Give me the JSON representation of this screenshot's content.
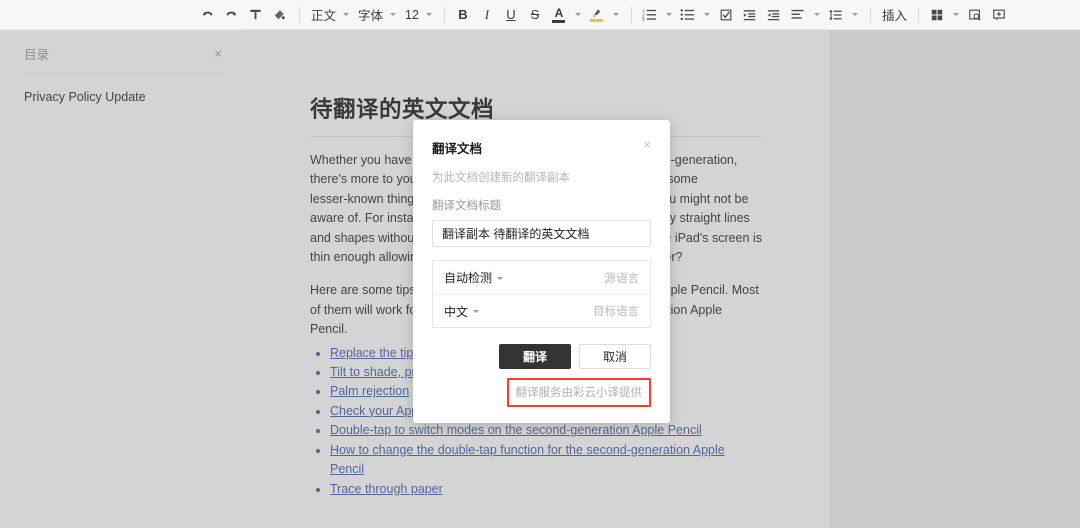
{
  "toolbar": {
    "undo_label": "undo",
    "redo_label": "redo",
    "clear_format_label": "clear-format",
    "format_painter_label": "format-painter",
    "style_label": "正文",
    "font_label": "字体",
    "font_size_label": "12",
    "bold_label": "B",
    "italic_label": "I",
    "underline_label": "U",
    "strike_label": "S",
    "text_color_label": "A",
    "highlight_label": "✎",
    "insert_label": "插入",
    "ordered_list_label": "ordered-list",
    "bullet_list_label": "bullet-list",
    "checklist_label": "checklist",
    "indent_increase_label": "indent-increase",
    "indent_decrease_label": "indent-decrease",
    "align_label": "align",
    "line_spacing_label": "line-spacing",
    "table_label": "table",
    "image_label": "image",
    "comment_label": "comment",
    "text_color_swatch": "#3c3c3c",
    "highlight_swatch": "#e8c44a"
  },
  "sidebar": {
    "title": "目录",
    "close_label": "×",
    "items": [
      {
        "label": "Privacy Policy Update"
      }
    ]
  },
  "document": {
    "title": "待翻译的英文文档",
    "paragraph": "Whether you have the first‑generation Apple Pencil or the second‑generation, there's more to your Apple Pencil than meets the eye. There are some lesser‑known things that you can do with the Apple Pencil that you might not be aware of. For instance, did you know that you could draw perfectly straight lines and shapes without using the Apple Pencil with a ruler, or that the iPad's screen is thin enough allowing you to trace something from a piece of paper?",
    "paragraph2": "Here are some tips and tricks to help you get more out of your Apple Pencil. Most of them will work for both the first‑generation and second‑generation Apple Pencil.",
    "links": [
      "Replace the tip",
      "Tilt to shade, press for thicker lines",
      "Palm rejection",
      "Check your Apple Pencil battery",
      "Double‑tap to switch modes on the second‑generation Apple Pencil",
      "How to change the double‑tap function for the second‑generation Apple Pencil",
      "Trace through paper"
    ]
  },
  "dialog": {
    "title": "翻译文档",
    "close_label": "×",
    "subtitle": "为此文档创建新的翻译副本",
    "field_label": "翻译文档标题",
    "field_value": "翻译副本 待翻译的英文文档",
    "source_lang_value": "自动检测",
    "source_lang_label": "源语言",
    "target_lang_value": "中文",
    "target_lang_label": "目标语言",
    "confirm_label": "翻译",
    "cancel_label": "取消",
    "footer_text": "翻译服务由彩云小译提供",
    "highlight_color": "#ff3b30"
  }
}
